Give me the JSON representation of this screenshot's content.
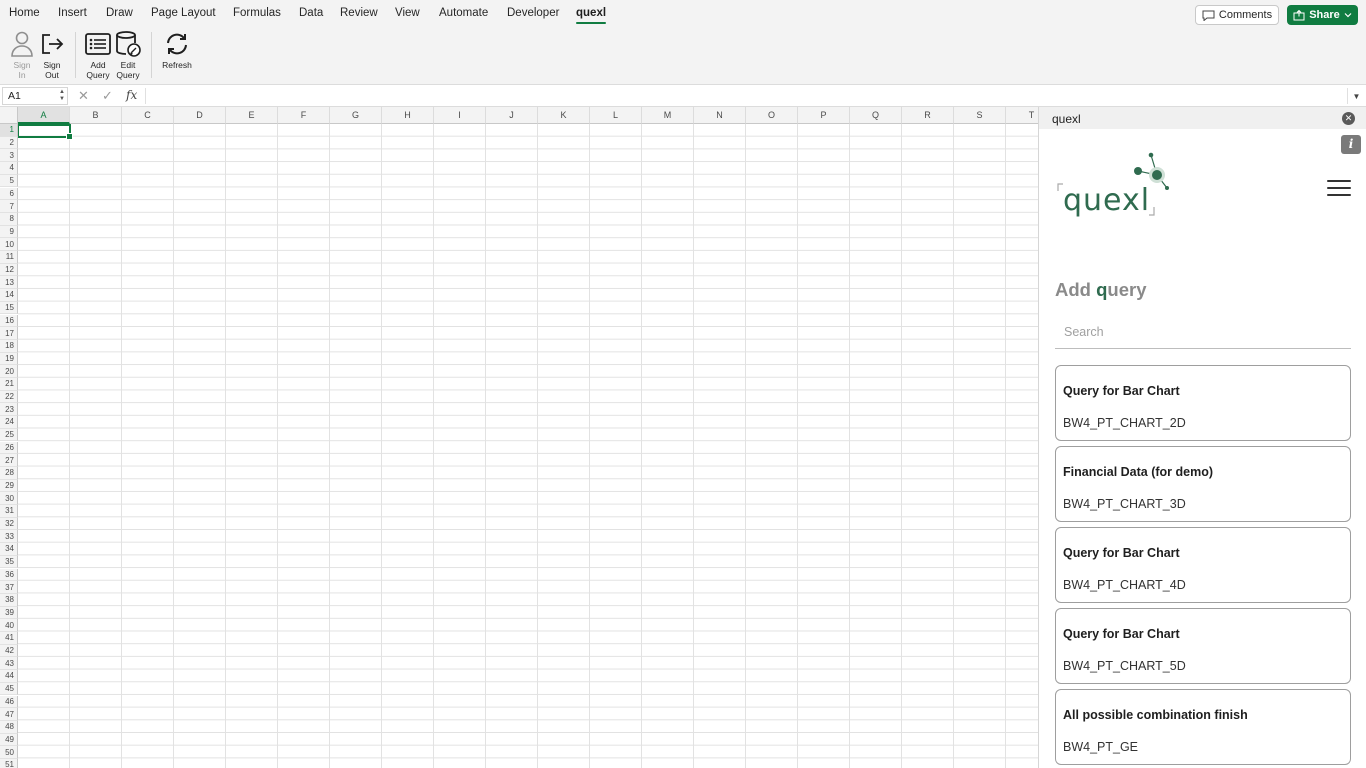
{
  "tabs": [
    "Home",
    "Insert",
    "Draw",
    "Page Layout",
    "Formulas",
    "Data",
    "Review",
    "View",
    "Automate",
    "Developer",
    "quexl"
  ],
  "active_tab": "quexl",
  "header_buttons": {
    "comments": "Comments",
    "share": "Share"
  },
  "ribbon": {
    "sign_in": [
      "Sign",
      "In"
    ],
    "sign_out": [
      "Sign",
      "Out"
    ],
    "add_query": [
      "Add",
      "Query"
    ],
    "edit_query": [
      "Edit",
      "Query"
    ],
    "refresh": "Refresh"
  },
  "formula_bar": {
    "name_box": "A1",
    "fx": "fx",
    "formula": ""
  },
  "grid": {
    "columns": [
      "A",
      "B",
      "C",
      "D",
      "E",
      "F",
      "G",
      "H",
      "I",
      "J",
      "K",
      "L",
      "M",
      "N",
      "O",
      "P",
      "Q",
      "R",
      "S",
      "T"
    ],
    "row_count": 51,
    "active_cell": "A1"
  },
  "pane": {
    "title": "quexl",
    "info": "i",
    "logo_text": "quexl",
    "section_title_prefix": "Add ",
    "section_title_accent": "q",
    "section_title_suffix": "uery",
    "search_placeholder": "Search",
    "queries": [
      {
        "title": "Query for Bar Chart",
        "id": "BW4_PT_CHART_2D"
      },
      {
        "title": "Financial Data (for demo)",
        "id": "BW4_PT_CHART_3D"
      },
      {
        "title": "Query for Bar Chart",
        "id": "BW4_PT_CHART_4D"
      },
      {
        "title": "Query for Bar Chart",
        "id": "BW4_PT_CHART_5D"
      },
      {
        "title": "All possible combination finish",
        "id": "BW4_PT_GE"
      }
    ]
  },
  "colors": {
    "accent_green": "#107c41",
    "brand_green": "#2f6b4f"
  }
}
